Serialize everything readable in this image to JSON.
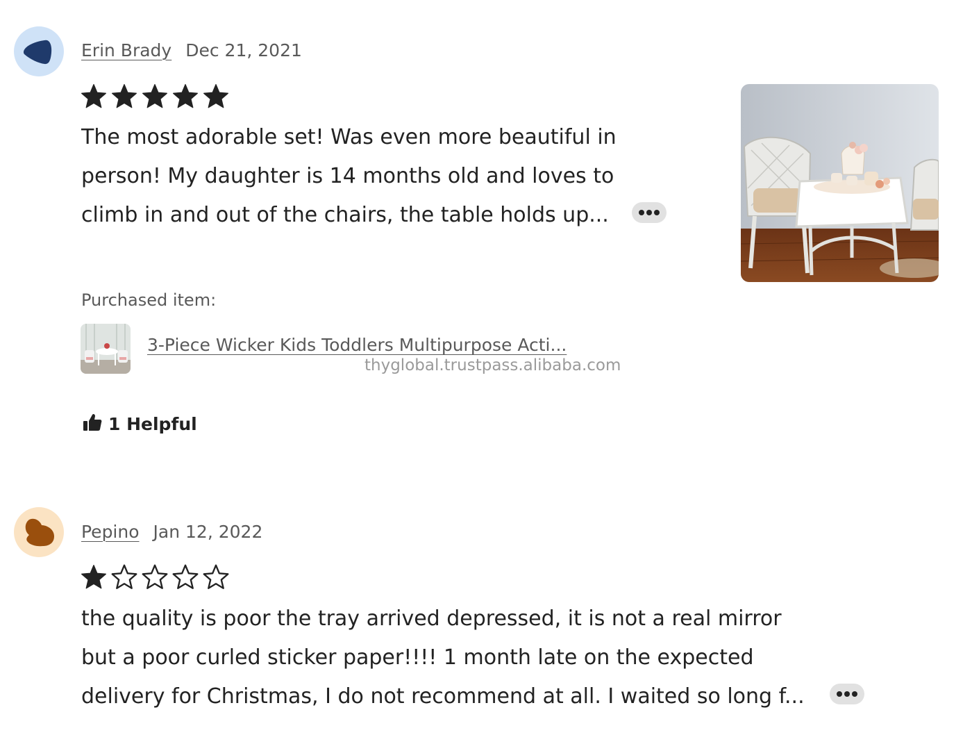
{
  "reviews": [
    {
      "reviewer": "Erin Brady",
      "date": "Dec 21, 2021",
      "rating": 5,
      "avatar_color": "#cfe2f7",
      "avatar_shape_color": "#1f3a6b",
      "text_lines": [
        "The most adorable set! Was even more beautiful in",
        "person! My daughter is 14 months old and loves to",
        "climb in and out of the chairs, the table holds up..."
      ],
      "more_icon": "ellipsis-icon",
      "purchased_label": "Purchased item:",
      "item_title": "3-Piece Wicker Kids Toddlers Multipurpose Acti...",
      "watermark": "thyglobal.trustpass.alibaba.com",
      "helpful_icon": "thumbs-up-icon",
      "helpful_label": "1 Helpful"
    },
    {
      "reviewer": "Pepino",
      "date": "Jan 12, 2022",
      "rating": 1,
      "avatar_color": "#fbe3c3",
      "avatar_shape_color": "#9a4f0d",
      "text_lines": [
        "the quality is poor the tray arrived depressed, it is not a real mirror",
        "but a poor curled sticker paper!!!! 1 month late on the expected",
        "delivery for Christmas, I do not recommend at all. I waited so long f..."
      ],
      "more_icon": "ellipsis-icon"
    }
  ],
  "max_rating": 5
}
